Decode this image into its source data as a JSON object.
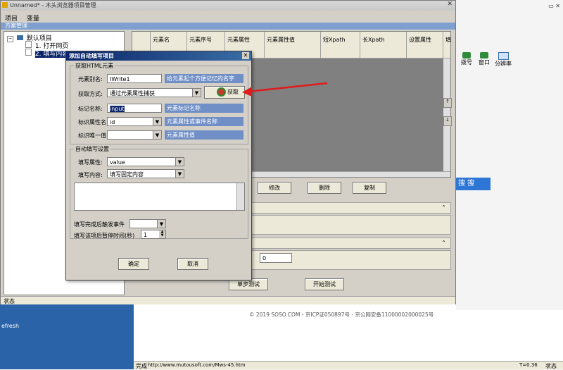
{
  "window": {
    "title": "Unnamed* - 木头浏览器项目管理",
    "menu": [
      "项目",
      "变量"
    ],
    "panel_title": "方案管理",
    "tree": {
      "root": "默认项目",
      "child1": "1. 打开网页",
      "child2": "2. 填写内容"
    },
    "grid_headers": [
      "元素名",
      "元素序号",
      "元素属性",
      "元素属性值",
      "短Xpath",
      "长Xpath",
      "设置属性",
      "填"
    ],
    "buttons": {
      "modify": "修改",
      "delete": "删除",
      "copy": "复制",
      "single_step": "单步测试",
      "start_test": "开始测试"
    },
    "spin_value": "0",
    "status": "状态"
  },
  "dialog": {
    "title": "添加自动填写项目",
    "group_get": "获取HTML元素",
    "alias_label": "元素别名:",
    "alias_value": "IWrite1",
    "alias_hint": "给元素起个方便记忆的名字",
    "method_label": "获取方式:",
    "method_value": "通过元素属性捕获",
    "get_button": "获取",
    "tag_label": "标记名称:",
    "tag_value": "input",
    "tag_hint": "元素标记名称",
    "attr_name_label": "标识属性名:",
    "attr_name_value": "id",
    "attr_name_hint": "元素属性或事件名称",
    "unique_label": "标识唯一值:",
    "unique_value": "",
    "unique_hint": "元素属性值",
    "group_fill": "自动填写设置",
    "fill_attr_label": "填写属性:",
    "fill_attr_value": "value",
    "fill_content_label": "填写内容:",
    "fill_content_value": "填写固定内容",
    "after_event_label": "填写完成后触发事件",
    "pause_label": "填写该项后暂停时间(秒)",
    "pause_value": "1",
    "ok": "确定",
    "cancel": "取消"
  },
  "browser": {
    "toolbar_icons": [
      {
        "name": "account-icon",
        "label": "拨号"
      },
      {
        "name": "window-icon",
        "label": "窗口"
      },
      {
        "name": "resolution-icon",
        "label": "分辨率"
      }
    ],
    "search_button": "搜 搜",
    "footer": "© 2019 SOSO.COM - 京ICP证050897号 - 京公网安备11000002000025号",
    "status_text": "完成",
    "status_url": "http://www.mutousoft.com/Mws-45.htm",
    "status_time": "T=0.36",
    "status_right": "状态"
  },
  "desktop": {
    "label": "efresh"
  }
}
